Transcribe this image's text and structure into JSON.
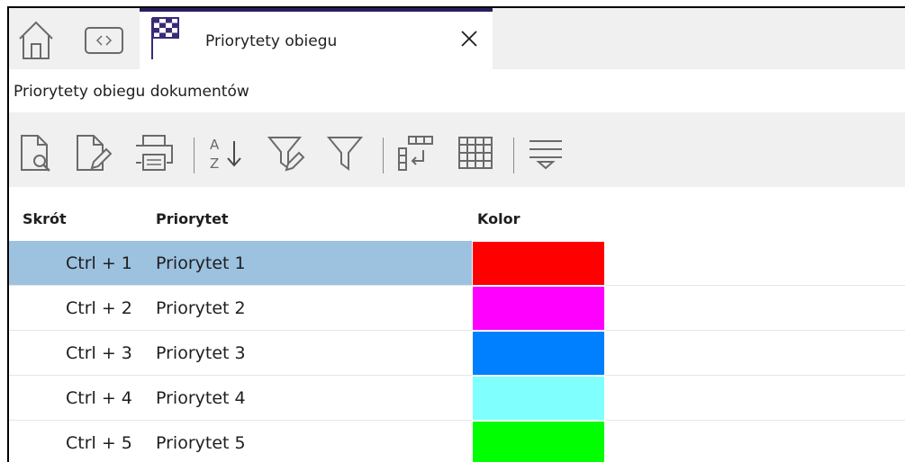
{
  "tab": {
    "label": "Priorytety obiegu",
    "accent": "#2d1e5e"
  },
  "page": {
    "title": "Priorytety obiegu dokumentów"
  },
  "toolbar": {
    "sort_letters": {
      "top": "A",
      "bottom": "Z"
    }
  },
  "table": {
    "columns": {
      "shortcut": "Skrót",
      "priority": "Priorytet",
      "color": "Kolor"
    },
    "rows": [
      {
        "shortcut": "Ctrl + 1",
        "priority": "Priorytet 1",
        "color": "#ff0000",
        "selected": true
      },
      {
        "shortcut": "Ctrl + 2",
        "priority": "Priorytet 2",
        "color": "#ff00ff",
        "selected": false
      },
      {
        "shortcut": "Ctrl + 3",
        "priority": "Priorytet 3",
        "color": "#0080ff",
        "selected": false
      },
      {
        "shortcut": "Ctrl + 4",
        "priority": "Priorytet 4",
        "color": "#80ffff",
        "selected": false
      },
      {
        "shortcut": "Ctrl + 5",
        "priority": "Priorytet 5",
        "color": "#00ff00",
        "selected": false
      }
    ]
  }
}
